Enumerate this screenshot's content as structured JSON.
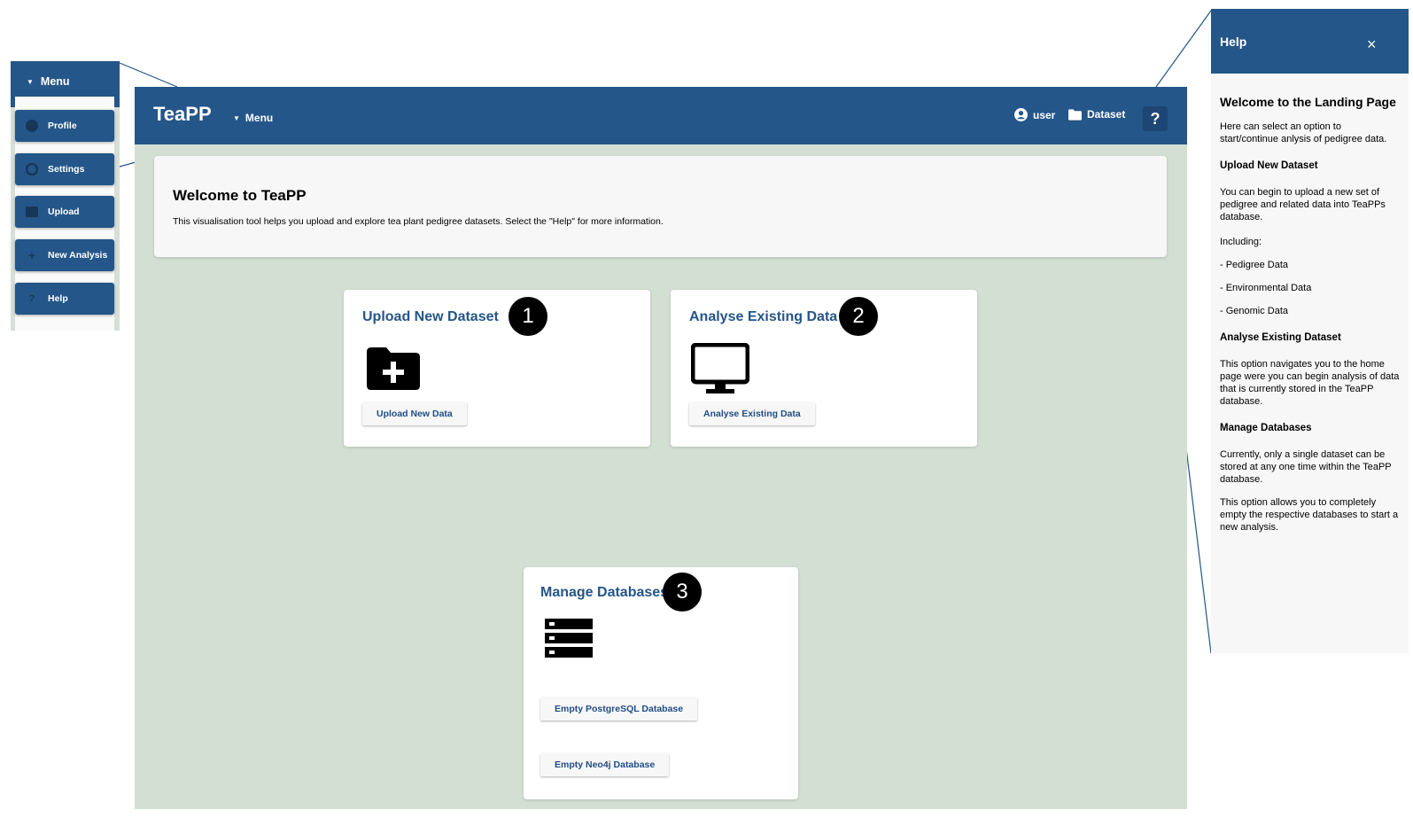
{
  "app": {
    "title": "TeaPP",
    "menu_label": "Menu",
    "user_label": "user",
    "dataset_label": "Dataset",
    "help_button": "?"
  },
  "welcome": {
    "title": "Welcome to TeaPP",
    "text": "This visualisation tool helps you upload and explore tea plant pedigree datasets. Select the \"Help\" for more information."
  },
  "cards": {
    "upload": {
      "title": "Upload New Dataset",
      "number": "1",
      "button": "Upload New Data",
      "icon": "folder-plus-icon"
    },
    "analyse": {
      "title": "Analyse Existing Data",
      "number": "2",
      "button": "Analyse Existing Data",
      "icon": "monitor-icon"
    },
    "manage": {
      "title": "Manage Databases",
      "number": "3",
      "button_postgres": "Empty PostgreSQL Database",
      "button_neo4j": "Empty Neo4j Database",
      "icon": "server-icon"
    }
  },
  "side_menu": {
    "title": "Menu",
    "items": [
      {
        "label": "Profile",
        "icon": "user-icon"
      },
      {
        "label": "Settings",
        "icon": "gear-icon"
      },
      {
        "label": "Upload",
        "icon": "folder-icon"
      },
      {
        "label": "New Analysis",
        "icon": "plus-icon"
      },
      {
        "label": "Help",
        "icon": "question-icon"
      }
    ]
  },
  "help_panel": {
    "title": "Help",
    "close": "×",
    "heading": "Welcome to the Landing Page",
    "intro": "Here can select an option to start/continue anlysis of pedigree data.",
    "upload_heading": "Upload New Dataset",
    "upload_text": "You can begin to upload a new set of pedigree and related data into TeaPPs database.",
    "including": "Including:",
    "item1": "- Pedigree Data",
    "item2": "- Environmental Data",
    "item3": "- Genomic Data",
    "analyse_heading": "Analyse Existing Dataset",
    "analyse_text": "This option navigates you to the home page were you can begin analysis of data that is currently stored in the TeaPP database.",
    "manage_heading": "Manage Databases",
    "manage_text1": "Currently, only a single dataset can be stored at any one time within the TeaPP database.",
    "manage_text2": "This option allows you to completely empty the respective databases to start a new analysis."
  },
  "colors": {
    "primary": "#245689",
    "background": "#d3dfd3",
    "link": "#1f4d86"
  }
}
